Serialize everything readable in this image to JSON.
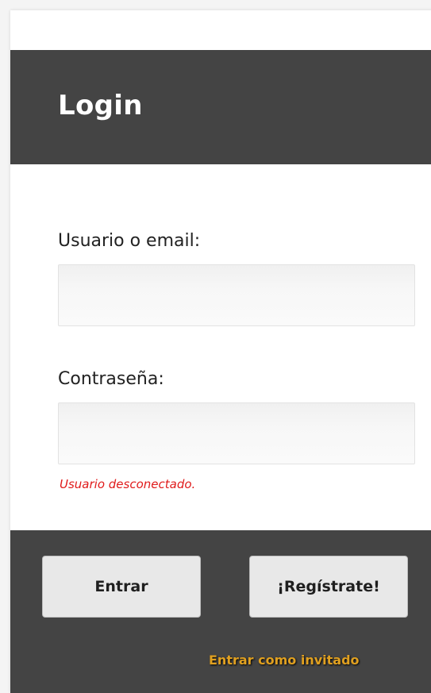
{
  "header": {
    "title": "Login"
  },
  "form": {
    "username_label": "Usuario o email:",
    "username_value": "",
    "password_label": "Contraseña:",
    "password_value": "",
    "status_message": "Usuario desconectado."
  },
  "footer": {
    "login_button": "Entrar",
    "register_button": "¡Regístrate!",
    "guest_link": "Entrar como invitado"
  },
  "colors": {
    "header_bg": "#444444",
    "status_text": "#e01b1b",
    "guest_link": "#e0a020"
  }
}
